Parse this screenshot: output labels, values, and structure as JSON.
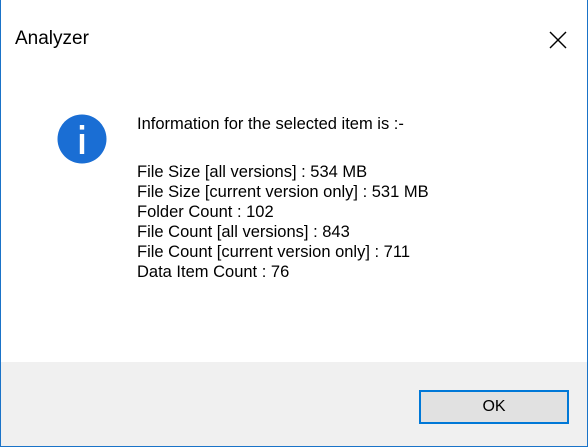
{
  "window": {
    "title": "Analyzer",
    "close_icon": "close-icon"
  },
  "dialog": {
    "icon": "info-icon",
    "heading": "Information for the selected item is :-",
    "lines": [
      "File Size [all versions] : 534 MB",
      "File Size [current version only] : 531 MB",
      "Folder Count : 102",
      "File Count [all versions] : 843",
      "File Count [current version only] : 711",
      "Data Item Count : 76"
    ]
  },
  "buttons": {
    "ok_label": "OK"
  },
  "colors": {
    "accent": "#0078d7",
    "info_icon_fill": "#1a6ed4",
    "footer_bg": "#f0f0f0",
    "window_border": "#1a73c8"
  }
}
